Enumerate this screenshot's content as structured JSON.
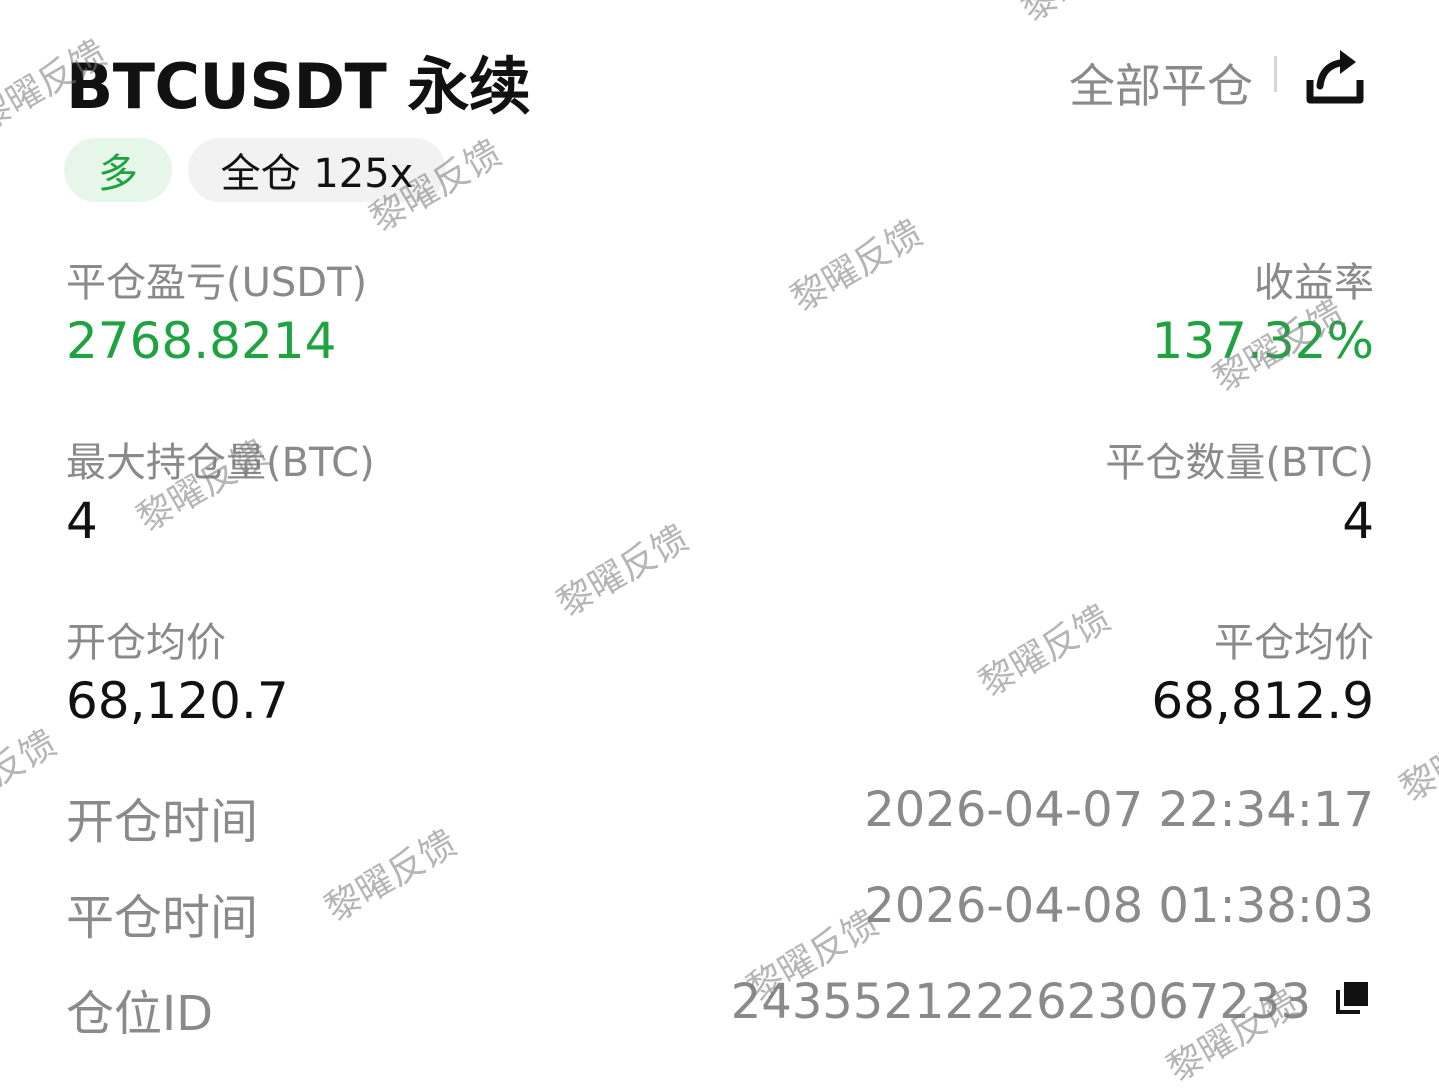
{
  "header": {
    "title": "BTCUSDT 永续",
    "close_all_label": "全部平仓",
    "share_icon": "share-icon"
  },
  "tags": {
    "direction": "多",
    "margin_mode": "全仓 125x"
  },
  "fields": {
    "realized_pnl_label": "平仓盈亏(USDT)",
    "realized_pnl_value": "2768.8214",
    "roi_label": "收益率",
    "roi_value": "137.32%",
    "max_position_label": "最大持仓量(BTC)",
    "max_position_value": "4",
    "closed_qty_label": "平仓数量(BTC)",
    "closed_qty_value": "4",
    "entry_price_label": "开仓均价",
    "entry_price_value": "68,120.7",
    "exit_price_label": "平仓均价",
    "exit_price_value": "68,812.9",
    "open_time_label": "开仓时间",
    "open_time_value": "2026-04-07 22:34:17",
    "close_time_label": "平仓时间",
    "close_time_value": "2026-04-08 01:38:03",
    "position_id_label": "仓位ID",
    "position_id_value": "2435521222623067233",
    "copy_icon": "copy-icon"
  },
  "colors": {
    "positive": "#1fa340",
    "label_gray": "#8a8a8a",
    "text_dark": "#111111",
    "tag_long_bg": "#e6f7ea",
    "tag_neutral_bg": "#f2f2f2"
  },
  "watermark": {
    "text": "黎曜反馈"
  }
}
